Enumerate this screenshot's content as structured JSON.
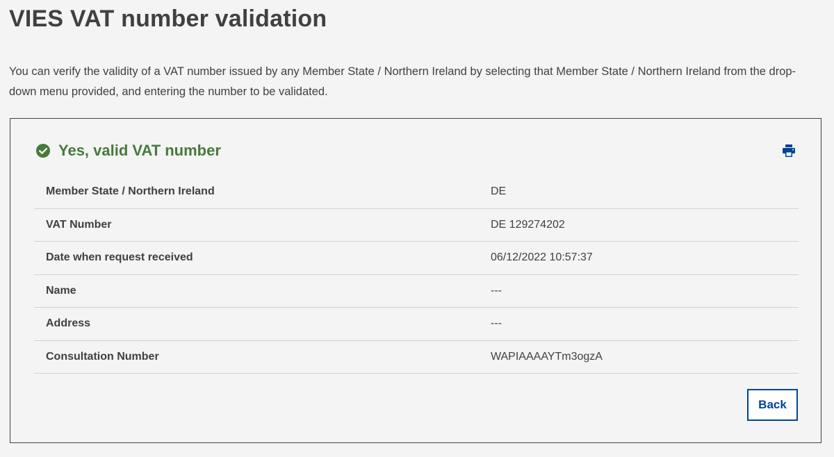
{
  "page": {
    "title": "VIES VAT number validation",
    "intro": "You can verify the validity of a VAT number issued by any Member State / Northern Ireland by selecting that Member State / Northern Ireland from the drop-down menu provided, and entering the number to be validated."
  },
  "result": {
    "status_text": "Yes, valid VAT number",
    "status_color": "#467a39",
    "status_icon": "check-circle-icon",
    "print_icon": "print-icon",
    "rows": [
      {
        "label": "Member State / Northern Ireland",
        "value": "DE"
      },
      {
        "label": "VAT Number",
        "value": "DE 129274202"
      },
      {
        "label": "Date when request received",
        "value": "06/12/2022 10:57:37"
      },
      {
        "label": "Name",
        "value": "---"
      },
      {
        "label": "Address",
        "value": "---"
      },
      {
        "label": "Consultation Number",
        "value": "WAPIAAAAYTm3ogzA"
      }
    ],
    "back_label": "Back",
    "accent_color": "#004494"
  }
}
